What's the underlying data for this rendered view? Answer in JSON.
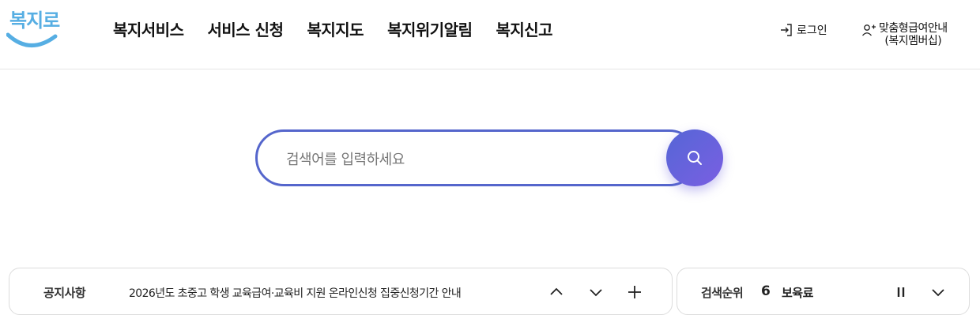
{
  "brand": {
    "logo_text": "복지로",
    "logo_color": "#56aee3"
  },
  "gnb": {
    "items": [
      {
        "label": "복지서비스"
      },
      {
        "label": "서비스 신청"
      },
      {
        "label": "복지지도"
      },
      {
        "label": "복지위기알림"
      },
      {
        "label": "복지신고"
      }
    ]
  },
  "util": {
    "login": {
      "label": "로그인",
      "icon": "login-icon"
    },
    "membership": {
      "line1": "맞춤형급여안내",
      "line2": "(복지멤버십)",
      "icon": "user-plus-icon"
    }
  },
  "search": {
    "placeholder": "검색어를 입력하세요",
    "value": "",
    "button_icon": "search-icon",
    "accent": "#5566cc"
  },
  "notice": {
    "label": "공지사항",
    "text": "2026년도 초중고 학생 교육급여·교육비 지원 온라인신청 집중신청기간 안내",
    "prev_icon": "chevron-up-icon",
    "next_icon": "chevron-down-icon",
    "more_icon": "plus-icon"
  },
  "ranking": {
    "label": "검색순위",
    "rank": "6",
    "keyword": "보육료",
    "pause_icon": "pause-icon",
    "expand_icon": "chevron-down-icon"
  }
}
